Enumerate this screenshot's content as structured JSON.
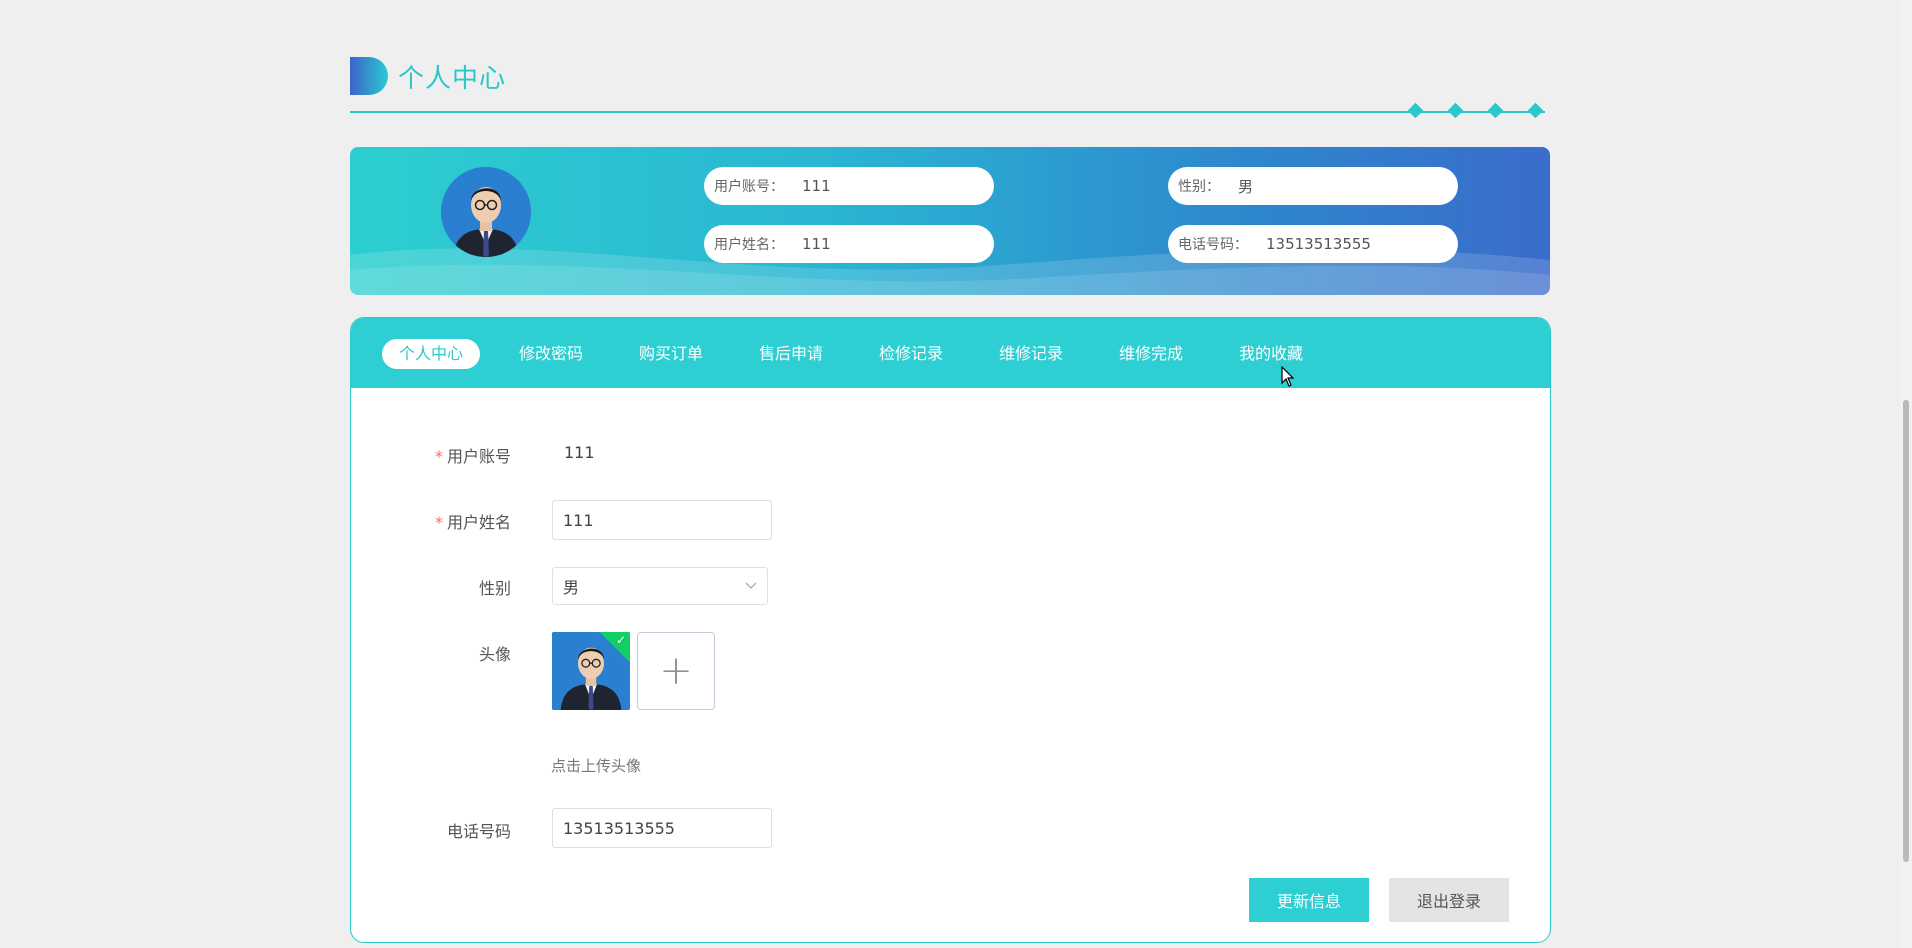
{
  "page": {
    "title": "个人中心"
  },
  "banner": {
    "account_label": "用户账号：",
    "account_value": "111",
    "name_label": "用户姓名：",
    "name_value": "111",
    "gender_label": "性别：",
    "gender_value": "男",
    "phone_label": "电话号码：",
    "phone_value": "13513513555"
  },
  "tabs": [
    "个人中心",
    "修改密码",
    "购买订单",
    "售后申请",
    "检修记录",
    "维修记录",
    "维修完成",
    "我的收藏"
  ],
  "active_tab": "个人中心",
  "form": {
    "account_label": "用户账号",
    "account_value": "111",
    "name_label": "用户姓名",
    "name_value": "111",
    "gender_label": "性别",
    "gender_value": "男",
    "avatar_label": "头像",
    "upload_tip": "点击上传头像",
    "phone_label": "电话号码",
    "phone_value": "13513513555",
    "required_mark": "*"
  },
  "buttons": {
    "update": "更新信息",
    "logout": "退出登录"
  },
  "icons": {
    "avatar": "user-photo-icon",
    "add": "plus-icon",
    "success": "check-icon",
    "dropdown": "chevron-down-icon"
  },
  "colors": {
    "accent": "#2ec7c9",
    "tabbar": "#2ecfd2",
    "required": "#f56c6c",
    "success": "#13ce66"
  }
}
